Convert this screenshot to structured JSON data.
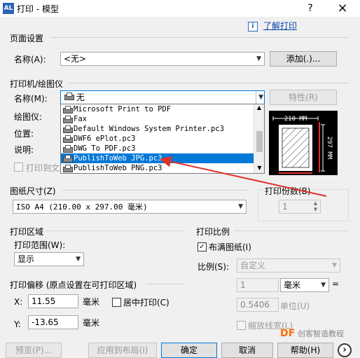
{
  "window": {
    "app_icon_text": "AL",
    "title": "打印 - 模型",
    "help_button": "?",
    "close_button": "×"
  },
  "help_link": "了解打印",
  "page_setup": {
    "group_title": "页面设置",
    "name_label": "名称(A):",
    "name_value": "<无>",
    "add_button": "添加(.)..."
  },
  "printer": {
    "group_title": "打印机/绘图仪",
    "name_label": "名称(M):",
    "name_value": "无",
    "properties_button": "特性(R)",
    "plotter_label": "绘图仪:",
    "location_label": "位置:",
    "description_label": "说明:",
    "print_to_file_label": "打印到文",
    "dropdown_items": [
      "Microsoft Print to PDF",
      "Fax",
      "Default Windows System Printer.pc3",
      "DWF6 ePlot.pc3",
      "DWG To PDF.pc3",
      "PublishToWeb JPG.pc3",
      "PublishToWeb PNG.pc3"
    ],
    "selected_index": 5,
    "preview_width": "210 MM",
    "preview_height": "297 MM"
  },
  "paper_size": {
    "group_title": "图纸尺寸(Z)",
    "value": "ISO A4 (210.00 x 297.00 毫米)"
  },
  "copies": {
    "group_title": "打印份数(B)",
    "value": "1"
  },
  "plot_area": {
    "group_title": "打印区域",
    "range_label": "打印范围(W):",
    "range_value": "显示"
  },
  "plot_offset": {
    "group_title": "打印偏移 (原点设置在可打印区域)",
    "x_label": "X:",
    "x_value": "11.55",
    "y_label": "Y:",
    "y_value": "-13.65",
    "unit": "毫米",
    "center_label": "居中打印(C)"
  },
  "plot_scale": {
    "group_title": "打印比例",
    "fit_label": "布满图纸(I)",
    "fit_checked": true,
    "scale_label": "比例(S):",
    "scale_value": "自定义",
    "scale_num": "1",
    "scale_unit": "毫米",
    "equals": "=",
    "unit_value": "0.5406",
    "unit_label": "单位(U)",
    "lineweight_label": "缩放线宽(L)"
  },
  "footer": {
    "preview_button": "预览(P)...",
    "apply_button": "应用到布局(I)",
    "ok_button": "确定",
    "cancel_button": "取消",
    "help_button": "帮助(H)",
    "expand_button": "›"
  },
  "watermark": {
    "logo": "DF",
    "text": "创客智造教程"
  },
  "colors": {
    "selection": "#0078d7",
    "annotation_arrow": "#e0302a",
    "link": "#0645ad"
  }
}
